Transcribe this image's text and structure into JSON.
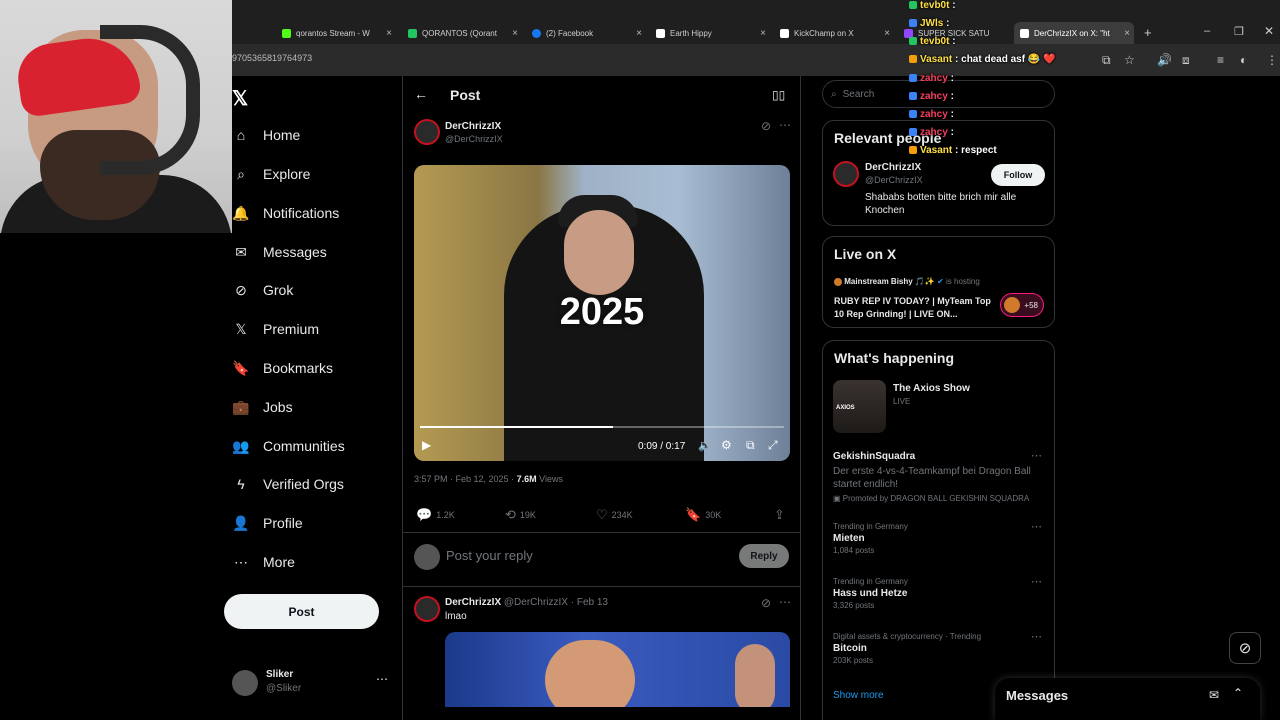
{
  "browser": {
    "tabs": [
      {
        "label": "qorantos Stream - W",
        "color": "#53fc18"
      },
      {
        "label": "QORANTOS (Qorant",
        "color": "#22c55e"
      },
      {
        "label": "(2) Facebook",
        "color": "#1877f2"
      },
      {
        "label": "Earth Hippy",
        "color": "#ffffff"
      },
      {
        "label": "KickChamp on X",
        "color": "#ffffff"
      },
      {
        "label": "SUPER SICK SATU",
        "color": "#9146ff"
      },
      {
        "label": "DerChrizzIX on X: \"ht",
        "color": "#ffffff"
      }
    ],
    "url": "9705365819764973"
  },
  "chat_overlay": [
    {
      "user": "tevb0t",
      "message": ""
    },
    {
      "user": "JWls",
      "message": ""
    },
    {
      "user": "tevb0t",
      "message": ""
    },
    {
      "user": "Vasant",
      "message": "chat dead asf 😂 ❤️"
    },
    {
      "user": "zahcy",
      "message": ""
    },
    {
      "user": "zahcy",
      "message": ""
    },
    {
      "user": "zahcy",
      "message": ""
    },
    {
      "user": "zahcy",
      "message": ""
    },
    {
      "user": "Vasant",
      "message": "respect"
    }
  ],
  "nav": {
    "logo": "𝕏",
    "items": [
      {
        "label": "Home",
        "icon": "home-icon",
        "glyph": "⌂"
      },
      {
        "label": "Explore",
        "icon": "search-icon",
        "glyph": "⌕"
      },
      {
        "label": "Notifications",
        "icon": "bell-icon",
        "glyph": "🔔"
      },
      {
        "label": "Messages",
        "icon": "mail-icon",
        "glyph": "✉"
      },
      {
        "label": "Grok",
        "icon": "grok-icon",
        "glyph": "⊘"
      },
      {
        "label": "Premium",
        "icon": "x-icon",
        "glyph": "𝕏"
      },
      {
        "label": "Bookmarks",
        "icon": "bookmark-icon",
        "glyph": "🔖"
      },
      {
        "label": "Jobs",
        "icon": "briefcase-icon",
        "glyph": "💼"
      },
      {
        "label": "Communities",
        "icon": "people-icon",
        "glyph": "👥"
      },
      {
        "label": "Verified Orgs",
        "icon": "lightning-icon",
        "glyph": "ϟ"
      },
      {
        "label": "Profile",
        "icon": "person-icon",
        "glyph": "👤"
      },
      {
        "label": "More",
        "icon": "more-circle-icon",
        "glyph": "⋯"
      }
    ],
    "post_label": "Post",
    "account": {
      "name": "Sliker",
      "handle": "@Sliker"
    }
  },
  "main": {
    "header_title": "Post",
    "post": {
      "author": "DerChrizzIX",
      "handle": "@DerChrizzIX",
      "video_overlay_text": "2025",
      "video_time": "0:09 / 0:17",
      "video_progress": 0.53,
      "timestamp": "3:57 PM · Feb 12, 2025 ·",
      "views_count": "7.6M",
      "views_label": "Views",
      "replies": "1.2K",
      "reposts": "19K",
      "likes": "234K",
      "bookmarks": "30K"
    },
    "reply_placeholder": "Post your reply",
    "reply_button": "Reply",
    "reply_post": {
      "author": "DerChrizzIX",
      "handle_date": "@DerChrizzIX · Feb 13",
      "text": "lmao"
    }
  },
  "sidebar": {
    "search_placeholder": "Search",
    "relevant": {
      "title": "Relevant people",
      "name": "DerChrizzIX",
      "handle": "@DerChrizzIX",
      "bio": "Shababs botten bitte brich mir alle Knochen",
      "follow_label": "Follow"
    },
    "live": {
      "title": "Live on X",
      "host": "Mainstream Bishy 🎵✨",
      "host_suffix": "is hosting",
      "description": "RUBY REP IV TODAY? | MyTeam Top 10 Rep Grinding! | LIVE ON...",
      "listeners": "+58"
    },
    "happening": {
      "title": "What's happening",
      "featured": {
        "title": "The Axios Show",
        "status": "LIVE",
        "thumb_label": "AXIOS"
      },
      "promo": {
        "title": "GekishinSquadra",
        "text": "Der erste 4-vs-4-Teamkampf bei Dragon Ball startet endlich!",
        "promoted": "Promoted by DRAGON BALL GEKISHIN SQUADRA"
      },
      "trends": [
        {
          "context": "Trending in Germany",
          "title": "Mieten",
          "posts": "1,084 posts"
        },
        {
          "context": "Trending in Germany",
          "title": "Hass und Hetze",
          "posts": "3,326 posts"
        },
        {
          "context": "Digital assets & cryptocurrency · Trending",
          "title": "Bitcoin",
          "posts": "203K posts"
        }
      ],
      "show_more": "Show more"
    },
    "messages_label": "Messages"
  }
}
